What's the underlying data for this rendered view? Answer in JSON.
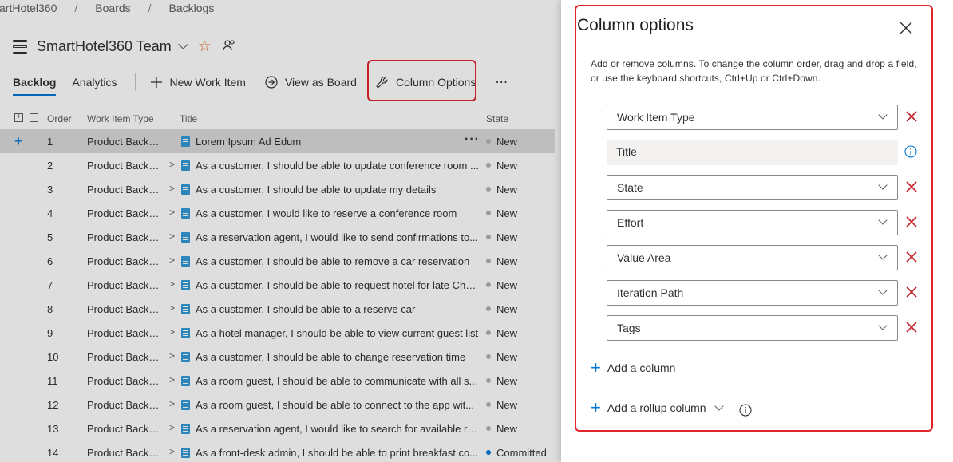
{
  "breadcrumb": {
    "project": "artHotel360",
    "boards": "Boards",
    "backlogs": "Backlogs",
    "separator": "/"
  },
  "team": {
    "name": "SmartHotel360 Team",
    "favorite_icon": "star-outline-icon",
    "members_icon": "people-icon"
  },
  "toolbar": {
    "tabs": [
      {
        "label": "Backlog",
        "active": true
      },
      {
        "label": "Analytics",
        "active": false
      }
    ],
    "new_work_item": "New Work Item",
    "view_as_board": "View as Board",
    "column_options": "Column Options",
    "more": "⋯"
  },
  "grid": {
    "headers": {
      "order": "Order",
      "type": "Work Item Type",
      "title": "Title",
      "state": "State"
    },
    "rows": [
      {
        "order": "1",
        "type": "Product Backlog Item",
        "title": "Lorem Ipsum Ad Edum",
        "state": "New",
        "selected": true
      },
      {
        "order": "2",
        "type": "Product Backlog Item",
        "title": "As a customer, I should be able to update conference room ...",
        "state": "New"
      },
      {
        "order": "3",
        "type": "Product Backlog Item",
        "title": "As a customer, I should be able to update my details",
        "state": "New"
      },
      {
        "order": "4",
        "type": "Product Backlog Item",
        "title": "As a customer, I would like to reserve a conference room",
        "state": "New"
      },
      {
        "order": "5",
        "type": "Product Backlog Item",
        "title": "As a reservation agent, I would like to send confirmations to...",
        "state": "New"
      },
      {
        "order": "6",
        "type": "Product Backlog Item",
        "title": "As a customer, I should be able to remove a car reservation",
        "state": "New"
      },
      {
        "order": "7",
        "type": "Product Backlog Item",
        "title": "As a customer, I should be able to request hotel for late Che...",
        "state": "New"
      },
      {
        "order": "8",
        "type": "Product Backlog Item",
        "title": "As a customer, I should be able to a reserve car",
        "state": "New"
      },
      {
        "order": "9",
        "type": "Product Backlog Item",
        "title": "As a hotel manager, I should be able to view current guest list",
        "state": "New"
      },
      {
        "order": "10",
        "type": "Product Backlog Item",
        "title": "As a customer, I should be able to change reservation time",
        "state": "New"
      },
      {
        "order": "11",
        "type": "Product Backlog Item",
        "title": "As a room guest, I should be able to communicate with all s...",
        "state": "New"
      },
      {
        "order": "12",
        "type": "Product Backlog Item",
        "title": "As a room guest, I should be able to connect to the app wit...",
        "state": "New"
      },
      {
        "order": "13",
        "type": "Product Backlog Item",
        "title": "As a reservation agent, I would like to search for available ro...",
        "state": "New"
      },
      {
        "order": "14",
        "type": "Product Backlog Item",
        "title": "As a front-desk admin, I should be able to print breakfast co...",
        "state": "Committed"
      }
    ]
  },
  "state_colors": {
    "New": "#b2b2b2",
    "Committed": "#0078d4"
  },
  "panel": {
    "title": "Column options",
    "description": "Add or remove columns. To change the column order, drag and drop a field, or use the keyboard shortcuts, Ctrl+Up or Ctrl+Down.",
    "columns": [
      {
        "label": "Work Item Type",
        "removable": true
      },
      {
        "label": "Title",
        "removable": false
      },
      {
        "label": "State",
        "removable": true
      },
      {
        "label": "Effort",
        "removable": true
      },
      {
        "label": "Value Area",
        "removable": true
      },
      {
        "label": "Iteration Path",
        "removable": true
      },
      {
        "label": "Tags",
        "removable": true
      }
    ],
    "add_column": "Add a column",
    "add_rollup_column": "Add a rollup column"
  },
  "colors": {
    "accent": "#0078d4",
    "remove": "#c4262e",
    "highlight_border": "#e0262b",
    "star": "#e8702a"
  }
}
